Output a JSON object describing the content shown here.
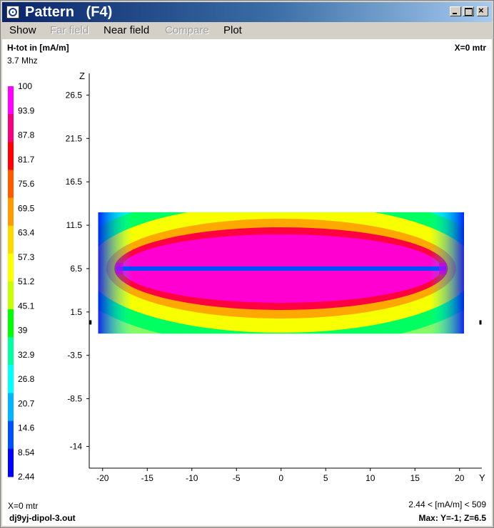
{
  "window": {
    "title": "Pattern   (F4)",
    "controls": [
      "minimize-icon",
      "maximize-icon",
      "close-icon"
    ]
  },
  "menu": [
    {
      "label": "Show",
      "enabled": true
    },
    {
      "label": "Far field",
      "enabled": false
    },
    {
      "label": "Near field",
      "enabled": true
    },
    {
      "label": "Compare",
      "enabled": false
    },
    {
      "label": "Plot",
      "enabled": true
    }
  ],
  "header": {
    "quantity": "H-tot in [mA/m]",
    "frequency": "3.7 Mhz",
    "slice": "X=0 mtr"
  },
  "legend": {
    "values": [
      "100",
      "93.9",
      "87.8",
      "81.7",
      "75.6",
      "69.5",
      "63.4",
      "57.3",
      "51.2",
      "45.1",
      "39",
      "32.9",
      "26.8",
      "20.7",
      "14.6",
      "8.54",
      "2.44"
    ],
    "colors": [
      "#ff00ff",
      "#f5007c",
      "#ff0000",
      "#ff5a00",
      "#ff9a00",
      "#ffd800",
      "#ffff00",
      "#c8ff00",
      "#00ff00",
      "#00ffa0",
      "#00ffff",
      "#00b4ff",
      "#0050ff",
      "#0000ff"
    ]
  },
  "chart_data": {
    "type": "heatmap",
    "title": "H-tot in [mA/m]",
    "xlabel": "Y",
    "ylabel": "Z",
    "x_ticks": [
      "-20",
      "-15",
      "-10",
      "-5",
      "0",
      "5",
      "10",
      "15",
      "20"
    ],
    "y_ticks": [
      "26.5",
      "21.5",
      "16.5",
      "11.5",
      "6.5",
      "1.5",
      "-3.5",
      "-8.5",
      "-14"
    ],
    "xlim": [
      -21.5,
      22.5
    ],
    "ylim": [
      -16.5,
      29
    ],
    "field_extent_y": [
      -20.5,
      20.5
    ],
    "field_extent_z": [
      -1,
      13
    ],
    "antenna": {
      "z": 6.5,
      "y_range": [
        -18.5,
        18.5
      ]
    },
    "scale": {
      "min": 2.44,
      "max": 100,
      "unit": "mA/m"
    },
    "colorbar_values": [
      100,
      93.9,
      87.8,
      81.7,
      75.6,
      69.5,
      63.4,
      57.3,
      51.2,
      45.1,
      39,
      32.9,
      26.8,
      20.7,
      14.6,
      8.54,
      2.44
    ]
  },
  "footer": {
    "slice": "X=0 mtr",
    "file": "dj9yj-dipol-3.out",
    "range": "2.44 < [mA/m] < 509",
    "max": "Max: Y=-1; Z=6.5"
  }
}
